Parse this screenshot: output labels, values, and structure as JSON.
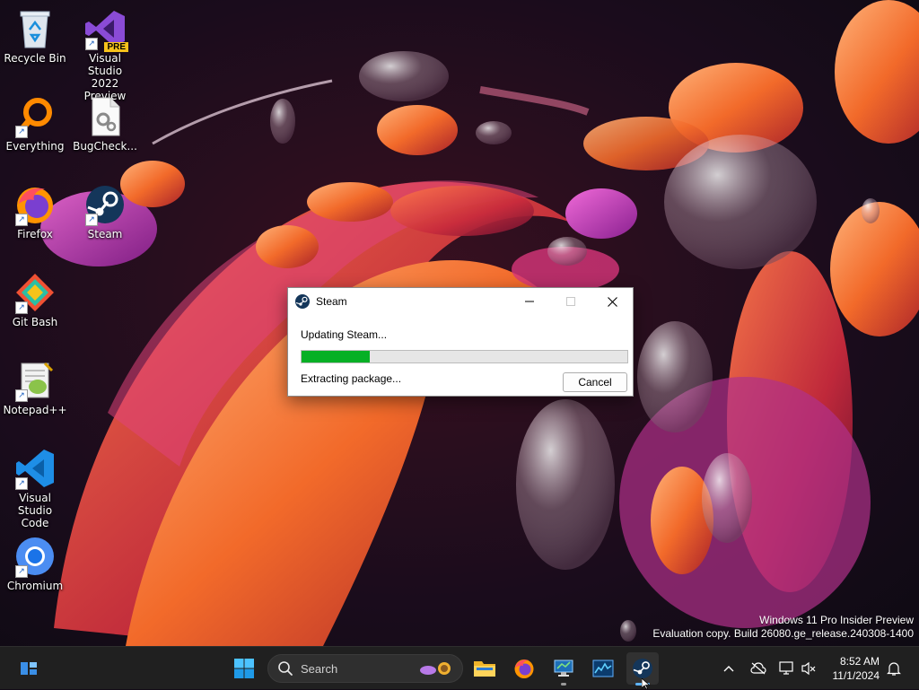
{
  "desktop": {
    "icons": [
      {
        "label": "Recycle Bin",
        "icon": "recycle-bin-icon"
      },
      {
        "label": "Visual Studio 2022 Preview",
        "label_line1": "Visual Studio",
        "label_line2": "2022 Preview",
        "badge": "PRE",
        "icon": "visual-studio-icon"
      },
      {
        "label": "Everything",
        "icon": "everything-search-icon"
      },
      {
        "label": "BugCheck...",
        "icon": "settings-file-icon"
      },
      {
        "label": "Firefox",
        "icon": "firefox-icon"
      },
      {
        "label": "Steam",
        "icon": "steam-icon"
      },
      {
        "label": "Git Bash",
        "icon": "git-bash-icon"
      },
      {
        "label": "Notepad++",
        "icon": "notepad-plus-plus-icon"
      },
      {
        "label": "Visual Studio Code",
        "label_line1": "Visual Studio",
        "label_line2": "Code",
        "icon": "vscode-icon"
      },
      {
        "label": "Chromium",
        "icon": "chromium-icon"
      }
    ],
    "watermark": {
      "line1": "Windows 11 Pro Insider Preview",
      "line2": "Evaluation copy. Build 26080.ge_release.240308-1400"
    }
  },
  "dialog": {
    "title": "Steam",
    "status": "Updating Steam...",
    "progress_percent": 21,
    "substatus": "Extracting package...",
    "cancel_label": "Cancel",
    "progress_color": "#06b025"
  },
  "taskbar": {
    "search_placeholder": "Search",
    "pinned": [
      "widgets-icon",
      "start-icon",
      "file-explorer-icon",
      "firefox-icon",
      "remote-desktop-icon",
      "task-manager-icon",
      "steam-icon"
    ],
    "tray": [
      "chevron-up-icon",
      "cloud-offline-icon",
      "network-icon",
      "volume-muted-icon",
      "notification-bell-icon"
    ],
    "clock": {
      "time": "8:52 AM",
      "date": "11/1/2024"
    }
  }
}
